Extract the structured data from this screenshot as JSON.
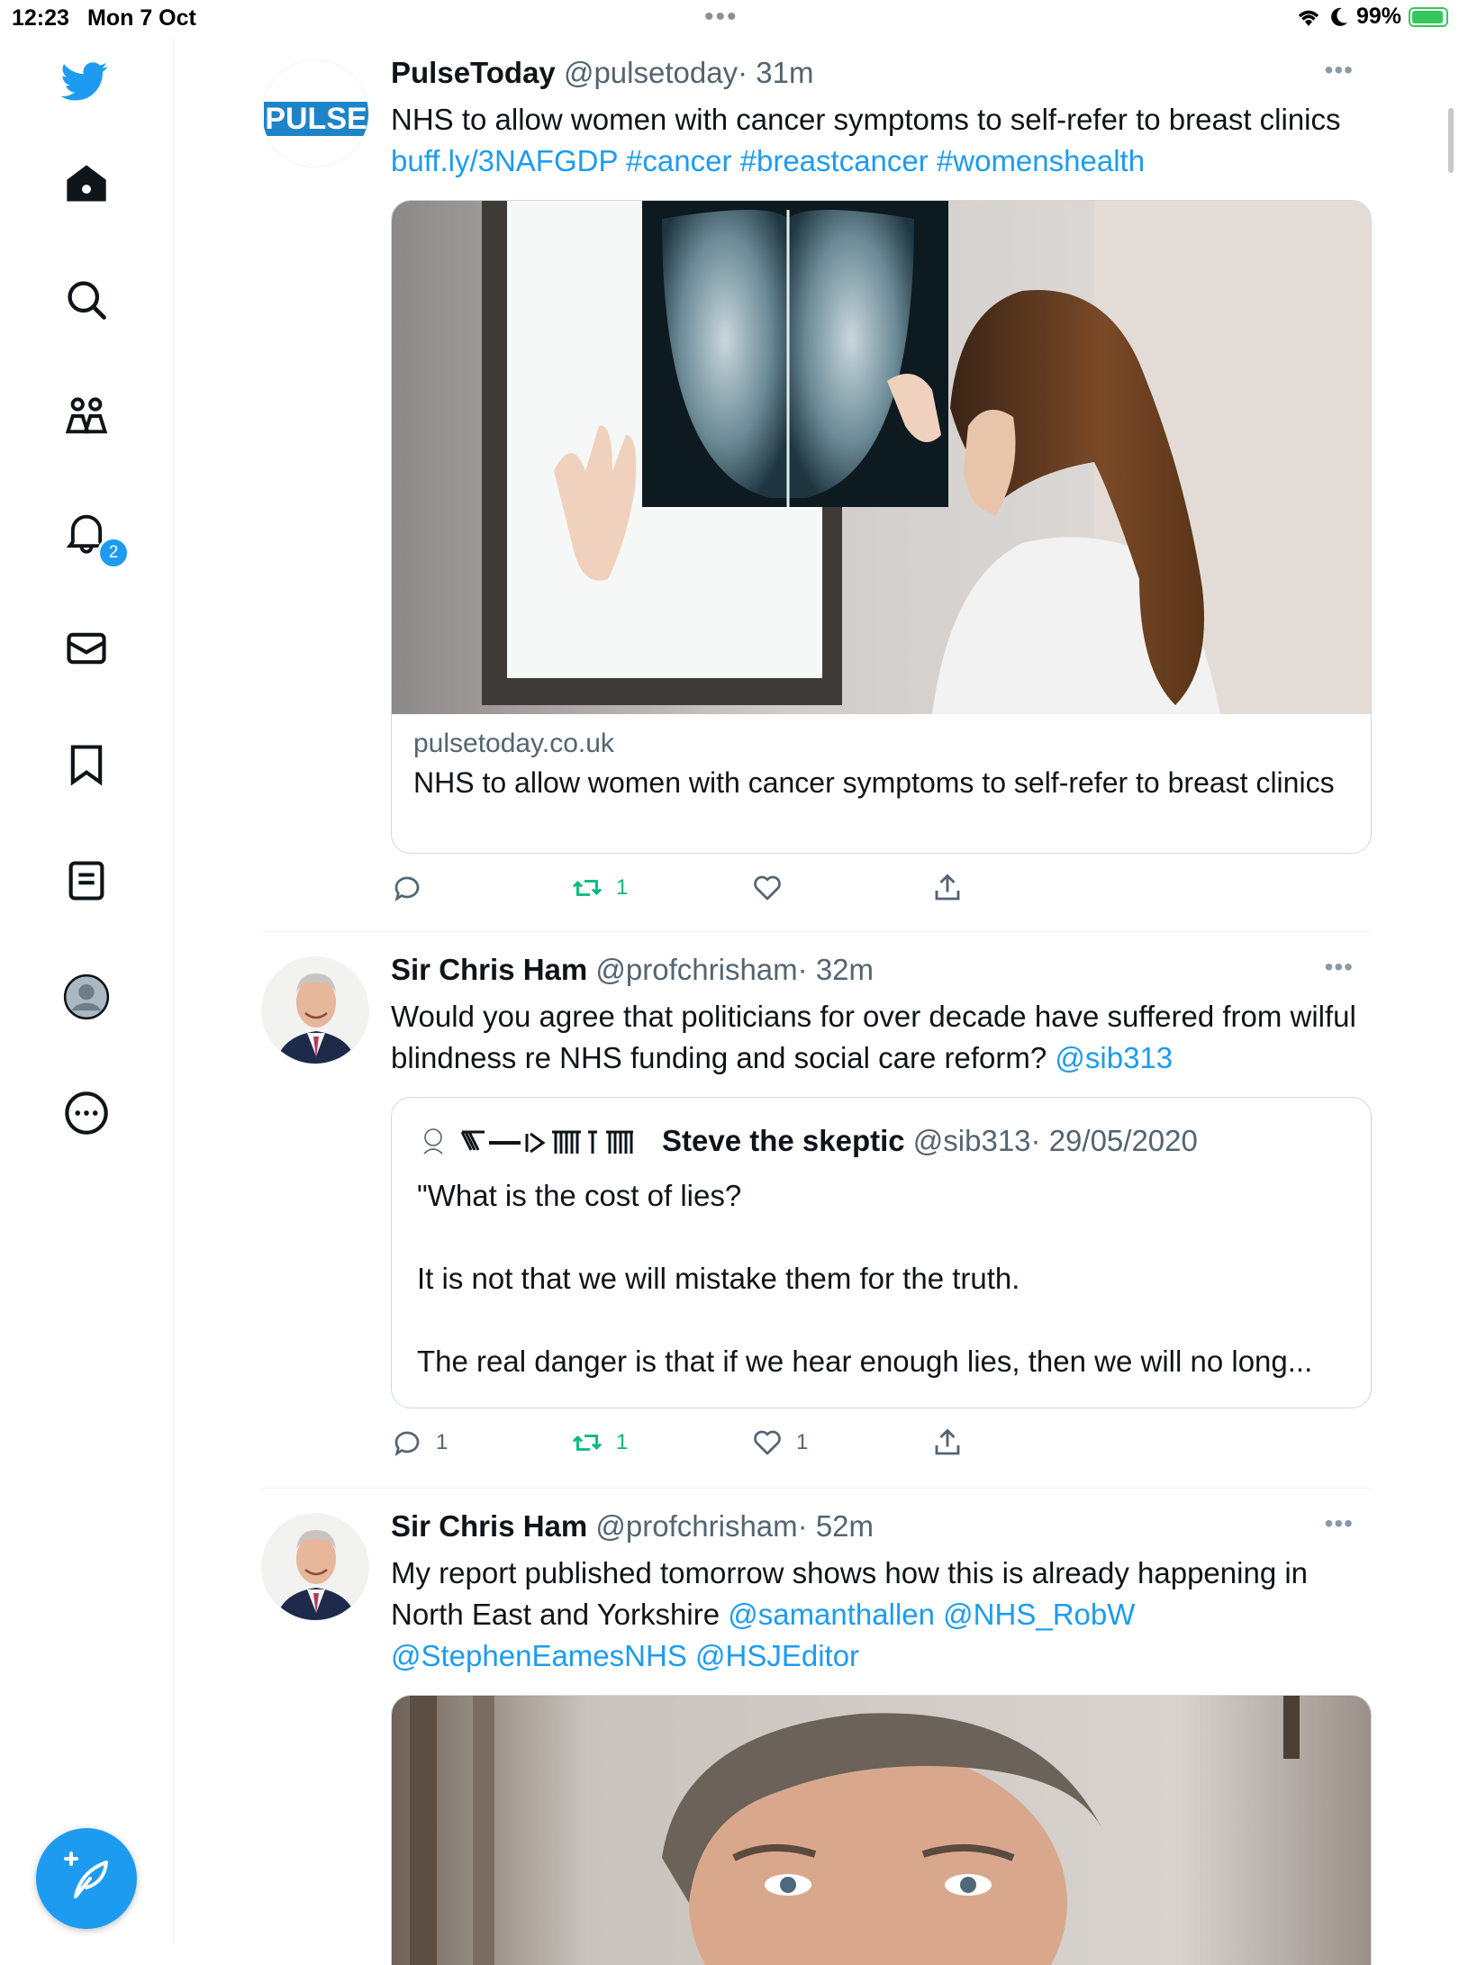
{
  "status_bar": {
    "time": "12:23",
    "date": "Mon 7 Oct",
    "battery": "99%"
  },
  "sidebar": {
    "items": [
      "twitter-logo",
      "home-icon",
      "search-icon",
      "communities-icon",
      "notifications-icon",
      "messages-icon",
      "bookmarks-icon",
      "lists-icon",
      "profile-icon",
      "more-icon"
    ],
    "notifications_badge": "2",
    "compose_label": "compose-tweet-icon"
  },
  "tweets": [
    {
      "name": "PulseToday",
      "handle": "@pulsetoday",
      "time": "· 31m",
      "avatar_text": "PULSE",
      "text": "NHS to allow women with cancer symptoms to self-refer to breast clinics ",
      "links": "buff.ly/3NAFGDP #cancer #breastcancer #womenshealth",
      "card": {
        "domain": "pulsetoday.co.uk",
        "title": "NHS to allow women with cancer symptoms to self-refer to breast clinics"
      },
      "retweets": "1"
    },
    {
      "name": "Sir Chris Ham",
      "handle": "@profchrisham",
      "time": "· 32m",
      "text": "Would you agree that politicians for over  decade have suffered from wilful blindness re NHS funding and social care reform? ",
      "links": "@sib313",
      "quote": {
        "name": "Steve the skeptic",
        "handle": "@sib313",
        "date": "· 29/05/2020",
        "line1": "\"What is the cost of lies?",
        "line2": "It is not that we will mistake them for the truth.",
        "line3": "The real danger is that if we hear enough lies, then we will no long..."
      },
      "replies": "1",
      "retweets": "1",
      "likes": "1"
    },
    {
      "name": "Sir Chris Ham",
      "handle": "@profchrisham",
      "time": "· 52m",
      "text": "My report published tomorrow shows how this is already happening in North East and Yorkshire ",
      "links": "@samanthallen @NHS_RobW @StephenEamesNHS @HSJEditor"
    }
  ],
  "colors": {
    "accent": "#1d9bf0",
    "retweet": "#00ba7c",
    "text": "#0f1419",
    "muted": "#536471"
  }
}
